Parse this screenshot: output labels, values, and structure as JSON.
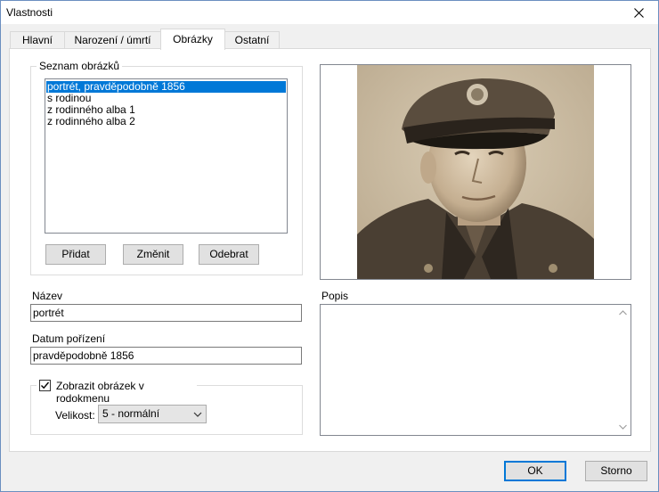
{
  "window": {
    "title": "Vlastnosti"
  },
  "tabs": [
    {
      "label": "Hlavní"
    },
    {
      "label": "Narození / úmrtí"
    },
    {
      "label": "Obrázky"
    },
    {
      "label": "Ostatní"
    }
  ],
  "active_tab": "Obrázky",
  "images_group": {
    "title": "Seznam obrázků",
    "items": [
      {
        "label": "portrét, pravděpodobně 1856",
        "selected": true
      },
      {
        "label": "s rodinou"
      },
      {
        "label": "z rodinného alba 1"
      },
      {
        "label": "z rodinného alba 2"
      }
    ],
    "add_label": "Přidat",
    "change_label": "Změnit",
    "remove_label": "Odebrat"
  },
  "fields": {
    "name_label": "Název",
    "name_value": "portrét",
    "date_label": "Datum pořízení",
    "date_value": "pravděpodobně 1856",
    "description_label": "Popis",
    "description_value": ""
  },
  "display_group": {
    "checkbox_label": "Zobrazit obrázek v rodokmenu",
    "checked": true,
    "size_label": "Velikost:",
    "size_value": "5 - normální"
  },
  "footer": {
    "ok_label": "OK",
    "cancel_label": "Storno"
  },
  "icons": {
    "close": "close-icon",
    "checkmark": "checkmark-icon",
    "dropdown": "chevron-down-icon",
    "scroll_up": "scroll-up-icon",
    "scroll_down": "scroll-down-icon"
  },
  "colors": {
    "selection": "#0078d7",
    "default_button_border": "#0078d7",
    "window_border": "#6b8fc0"
  }
}
